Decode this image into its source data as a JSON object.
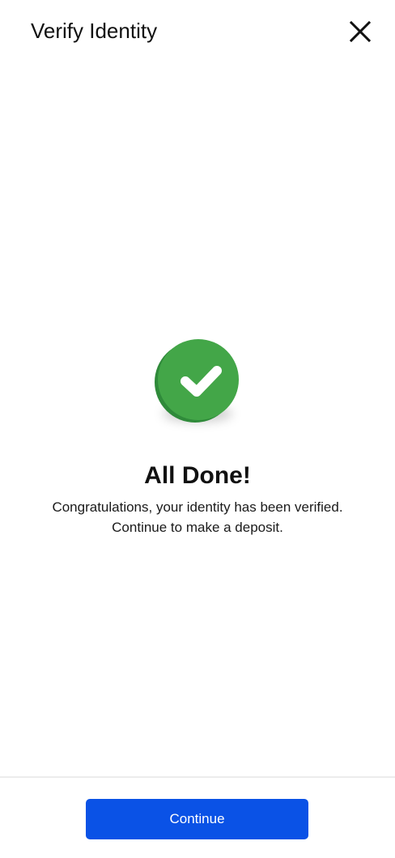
{
  "header": {
    "title": "Verify Identity",
    "close_icon": "close-icon"
  },
  "status": {
    "icon": "check-circle-icon",
    "title": "All Done!",
    "message_line1": "Congratulations, your identity has been verified.",
    "message_line2": "Continue to make a deposit."
  },
  "footer": {
    "continue_label": "Continue"
  },
  "colors": {
    "accent": "#0a52e6",
    "success": "#43a648",
    "text": "#111111",
    "background": "#ffffff"
  }
}
